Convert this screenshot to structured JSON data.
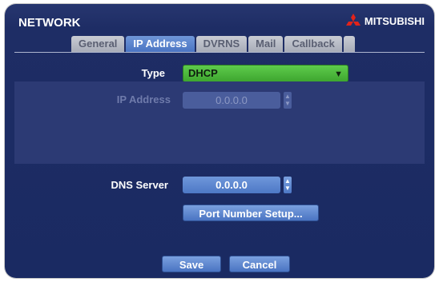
{
  "window": {
    "title": "NETWORK"
  },
  "brand": {
    "name": "MITSUBISHI",
    "logo_icon": "mitsubishi-three-diamonds",
    "logo_color": "#e2231a"
  },
  "tabs": [
    {
      "label": "General",
      "active": false
    },
    {
      "label": "IP Address",
      "active": true
    },
    {
      "label": "DVRNS",
      "active": false
    },
    {
      "label": "Mail",
      "active": false
    },
    {
      "label": "Callback",
      "active": false
    }
  ],
  "type_field": {
    "label": "Type",
    "value": "DHCP",
    "accent": "#4ab83a"
  },
  "ip_field": {
    "label": "IP Address",
    "value": "0.0.0.0",
    "disabled": true
  },
  "dns_field": {
    "label": "DNS Server",
    "value": "0.0.0.0"
  },
  "port_button": {
    "label": "Port Number Setup..."
  },
  "footer": {
    "save_label": "Save",
    "cancel_label": "Cancel"
  }
}
